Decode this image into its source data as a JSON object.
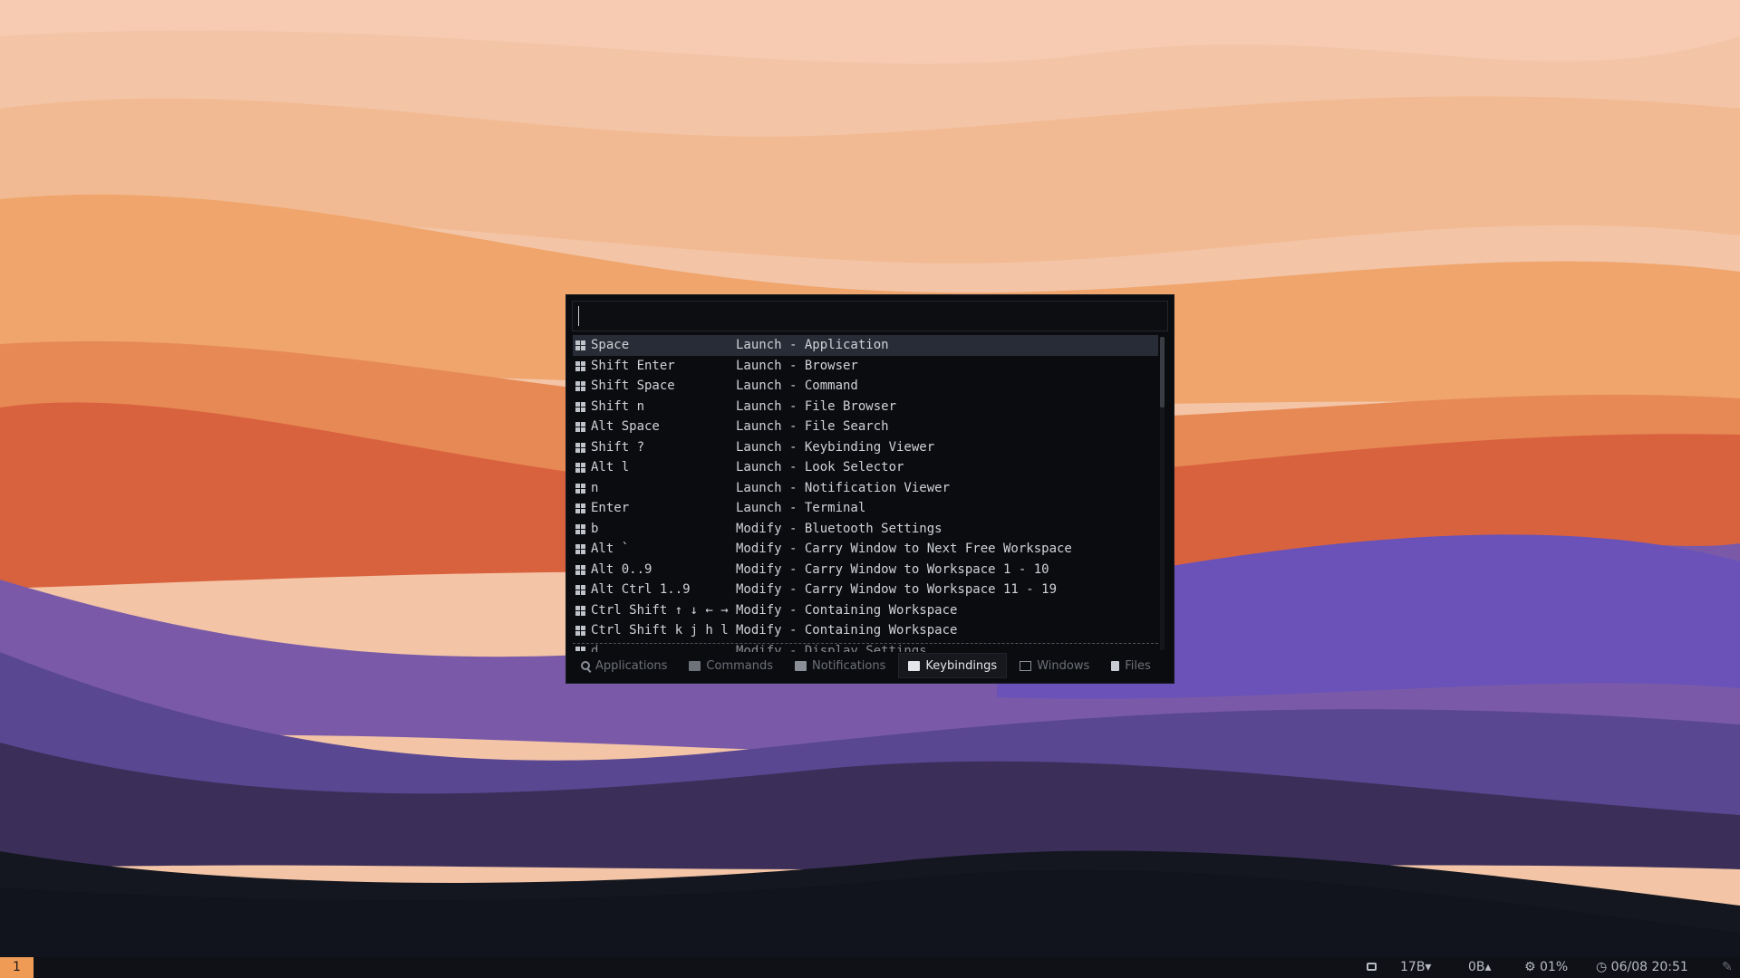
{
  "search": {
    "value": "",
    "placeholder": ""
  },
  "keybindings": [
    {
      "keys": "Space",
      "action": "Launch - Application",
      "selected": true
    },
    {
      "keys": "Shift Enter",
      "action": "Launch - Browser"
    },
    {
      "keys": "Shift Space",
      "action": "Launch - Command"
    },
    {
      "keys": "Shift n",
      "action": "Launch - File Browser"
    },
    {
      "keys": "Alt Space",
      "action": "Launch - File Search"
    },
    {
      "keys": "Shift ?",
      "action": "Launch - Keybinding Viewer"
    },
    {
      "keys": "Alt l",
      "action": "Launch - Look Selector"
    },
    {
      "keys": "n",
      "action": "Launch - Notification Viewer"
    },
    {
      "keys": "Enter",
      "action": "Launch - Terminal"
    },
    {
      "keys": "b",
      "action": "Modify - Bluetooth Settings"
    },
    {
      "keys": "Alt `",
      "action": "Modify - Carry Window to Next Free Workspace"
    },
    {
      "keys": "Alt 0..9",
      "action": "Modify - Carry Window to Workspace 1 - 10"
    },
    {
      "keys": "Alt Ctrl 1..9",
      "action": "Modify - Carry Window to Workspace 11 - 19"
    },
    {
      "keys": "Ctrl Shift ↑ ↓ ← →",
      "action": "Modify - Containing Workspace"
    },
    {
      "keys": "Ctrl Shift k j h l",
      "action": "Modify - Containing Workspace"
    },
    {
      "keys": "d",
      "action": "Modify - Display Settings"
    }
  ],
  "tabs": [
    {
      "label": "Applications",
      "icon": "search-icon"
    },
    {
      "label": "Commands",
      "icon": "terminal-icon"
    },
    {
      "label": "Notifications",
      "icon": "bell-icon"
    },
    {
      "label": "Keybindings",
      "icon": "keyboard-icon",
      "active": true
    },
    {
      "label": "Windows",
      "icon": "window-icon"
    },
    {
      "label": "Files",
      "icon": "file-icon"
    }
  ],
  "taskbar": {
    "workspace": "1",
    "net_down": "17B▾",
    "net_up": "0B▴",
    "cpu": "01%",
    "clock": "06/08 20:51"
  },
  "colors": {
    "accent": "#ef9a55",
    "launcher_bg": "#0b0c10",
    "selected_row": "#282c36"
  }
}
